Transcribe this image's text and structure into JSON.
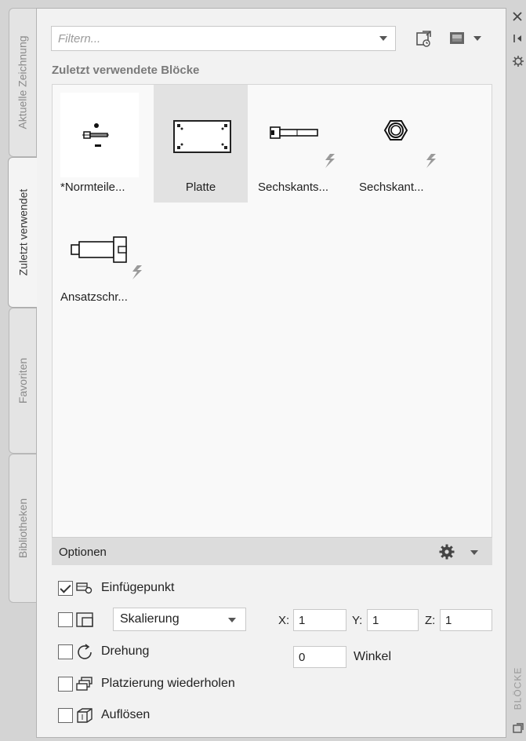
{
  "tabs": [
    {
      "label": "Aktuelle Zeichnung",
      "active": false
    },
    {
      "label": "Zuletzt verwendet",
      "active": true
    },
    {
      "label": "Favoriten",
      "active": false
    },
    {
      "label": "Bibliotheken",
      "active": false
    }
  ],
  "filter": {
    "placeholder": "Filtern...",
    "value": ""
  },
  "section_title": "Zuletzt verwendete Blöcke",
  "blocks": [
    {
      "label": "*Normteile...",
      "icon": "normteil-icon",
      "selected": false,
      "dynamic": false
    },
    {
      "label": "Platte",
      "icon": "plate-icon",
      "selected": true,
      "dynamic": false
    },
    {
      "label": "Sechskants...",
      "icon": "hex-bolt-icon",
      "selected": false,
      "dynamic": true
    },
    {
      "label": "Sechskant...",
      "icon": "hex-nut-icon",
      "selected": false,
      "dynamic": true
    },
    {
      "label": "Ansatzschr...",
      "icon": "shoulder-screw-icon",
      "selected": false,
      "dynamic": true
    }
  ],
  "options": {
    "title": "Optionen",
    "insertion_point": {
      "label": "Einfügepunkt",
      "checked": true
    },
    "scale": {
      "checked": false,
      "mode": "Skalierung",
      "x_label": "X:",
      "x": "1",
      "y_label": "Y:",
      "y": "1",
      "z_label": "Z:",
      "z": "1"
    },
    "rotation": {
      "label": "Drehung",
      "checked": false,
      "value": "0",
      "unit_label": "Winkel"
    },
    "repeat": {
      "label": "Platzierung wiederholen",
      "checked": false
    },
    "explode": {
      "label": "Auflösen",
      "checked": false
    }
  },
  "palette_title": "BLÖCKE",
  "colors": {
    "accent": "#f2f2f2",
    "lightning": "#9a9a9a"
  }
}
